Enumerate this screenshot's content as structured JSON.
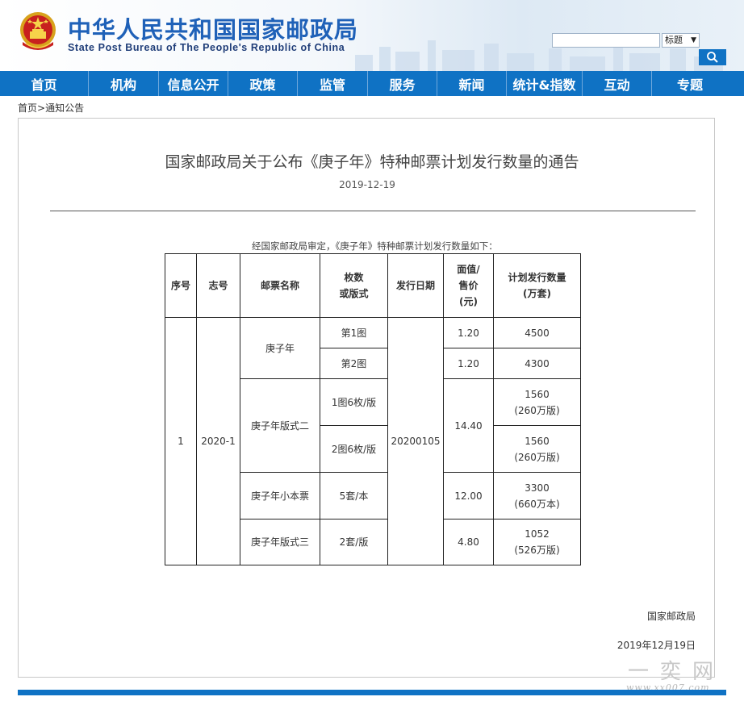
{
  "header": {
    "title_cn": "中华人民共和国国家邮政局",
    "title_en": "State Post Bureau of The People's Republic of China",
    "search": {
      "value": "",
      "select_label": "标题",
      "arrow": "▼",
      "button_icon": "search-icon"
    },
    "colors": {
      "brand_blue": "#1f61b8",
      "nav_blue": "#0f72c4"
    }
  },
  "nav": {
    "items": [
      {
        "label": "首页"
      },
      {
        "label": "机构"
      },
      {
        "label": "信息公开"
      },
      {
        "label": "政策"
      },
      {
        "label": "监管"
      },
      {
        "label": "服务"
      },
      {
        "label": "新闻"
      },
      {
        "label": "统计&指数"
      },
      {
        "label": "互动"
      },
      {
        "label": "专题"
      }
    ]
  },
  "breadcrumb": {
    "home": "首页",
    "sep": ">",
    "current": "通知公告"
  },
  "article": {
    "title": "国家邮政局关于公布《庚子年》特种邮票计划发行数量的通告",
    "date": "2019-12-19",
    "intro": "经国家邮政局审定，《庚子年》特种邮票计划发行数量如下：",
    "signature_org": "国家邮政局",
    "signature_date": "2019年12月19日"
  },
  "table": {
    "headers": {
      "no": "序号",
      "code": "志号",
      "name": "邮票名称",
      "count_l1": "枚数",
      "count_l2": "或版式",
      "date": "发行日期",
      "price_l1": "面值/",
      "price_l2": "售价",
      "price_l3": "(元)",
      "qty_l1": "计划发行数量",
      "qty_l2": "(万套)"
    },
    "no": "1",
    "code": "2020-1",
    "issue_date": "20200105",
    "groups": [
      {
        "name": "庚子年",
        "rows": [
          {
            "format": "第1图",
            "price": "1.20",
            "qty": "4500",
            "qty_note": ""
          },
          {
            "format": "第2图",
            "price": "1.20",
            "qty": "4300",
            "qty_note": ""
          }
        ]
      },
      {
        "name": "庚子年版式二",
        "price": "14.40",
        "rows": [
          {
            "format": "1图6枚/版",
            "qty": "1560",
            "qty_note": "(260万版)"
          },
          {
            "format": "2图6枚/版",
            "qty": "1560",
            "qty_note": "(260万版)"
          }
        ]
      },
      {
        "name": "庚子年小本票",
        "rows": [
          {
            "format": "5套/本",
            "price": "12.00",
            "qty": "3300",
            "qty_note": "(660万本)"
          }
        ]
      },
      {
        "name": "庚子年版式三",
        "rows": [
          {
            "format": "2套/版",
            "price": "4.80",
            "qty": "1052",
            "qty_note": "(526万版)"
          }
        ]
      }
    ]
  },
  "watermark": {
    "big": "一奕网",
    "small": "www.xx007.com"
  }
}
